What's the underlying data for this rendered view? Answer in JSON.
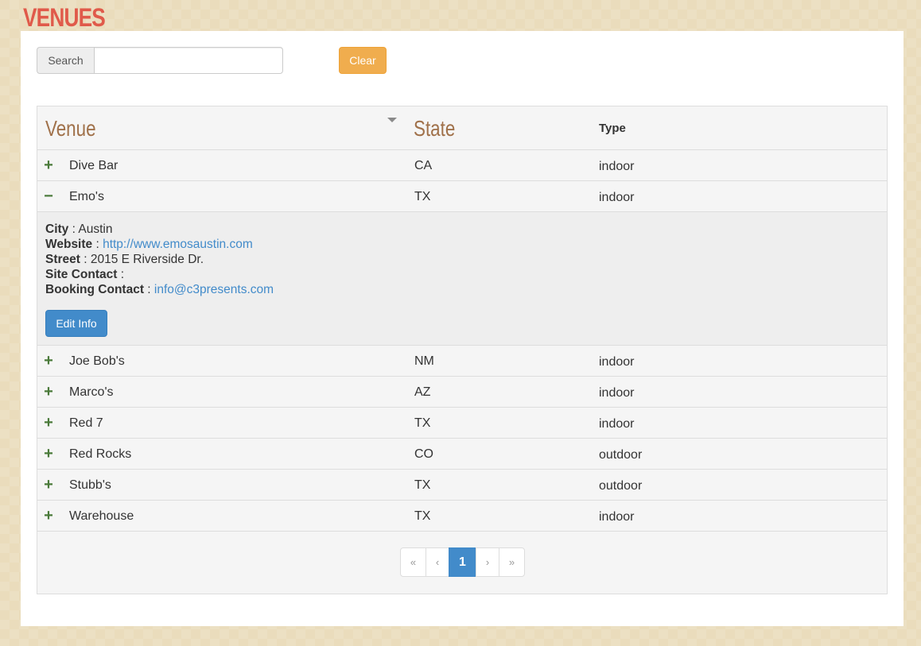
{
  "page_title": "VENUES",
  "search": {
    "label": "Search",
    "value": "",
    "placeholder": ""
  },
  "clear_label": "Clear",
  "table": {
    "headers": {
      "venue": "Venue",
      "state": "State",
      "type": "Type"
    },
    "rows": [
      {
        "toggle": "+",
        "venue": "Dive Bar",
        "state": "CA",
        "type": "indoor"
      },
      {
        "toggle": "−",
        "venue": "Emo's",
        "state": "TX",
        "type": "indoor"
      },
      {
        "toggle": "+",
        "venue": "Joe Bob's",
        "state": "NM",
        "type": "indoor"
      },
      {
        "toggle": "+",
        "venue": "Marco's",
        "state": "AZ",
        "type": "indoor"
      },
      {
        "toggle": "+",
        "venue": "Red 7",
        "state": "TX",
        "type": "indoor"
      },
      {
        "toggle": "+",
        "venue": "Red Rocks",
        "state": "CO",
        "type": "outdoor"
      },
      {
        "toggle": "+",
        "venue": "Stubb's",
        "state": "TX",
        "type": "outdoor"
      },
      {
        "toggle": "+",
        "venue": "Warehouse",
        "state": "TX",
        "type": "indoor"
      }
    ],
    "details": {
      "city_label": "City",
      "city": "Austin",
      "website_label": "Website",
      "website": "http://www.emosaustin.com",
      "street_label": "Street",
      "street": "2015 E Riverside Dr.",
      "site_contact_label": "Site Contact",
      "site_contact": "",
      "booking_contact_label": "Booking Contact",
      "booking_contact": "info@c3presents.com",
      "edit_label": "Edit Info"
    }
  },
  "pagination": {
    "first": "«",
    "prev": "‹",
    "current": "1",
    "next": "›",
    "last": "»"
  },
  "colors": {
    "accent_red": "#e05a4a",
    "header_brown": "#a0714a",
    "warning": "#f0ad4e",
    "primary": "#428bca",
    "toggle_green": "#4a7a3a"
  }
}
